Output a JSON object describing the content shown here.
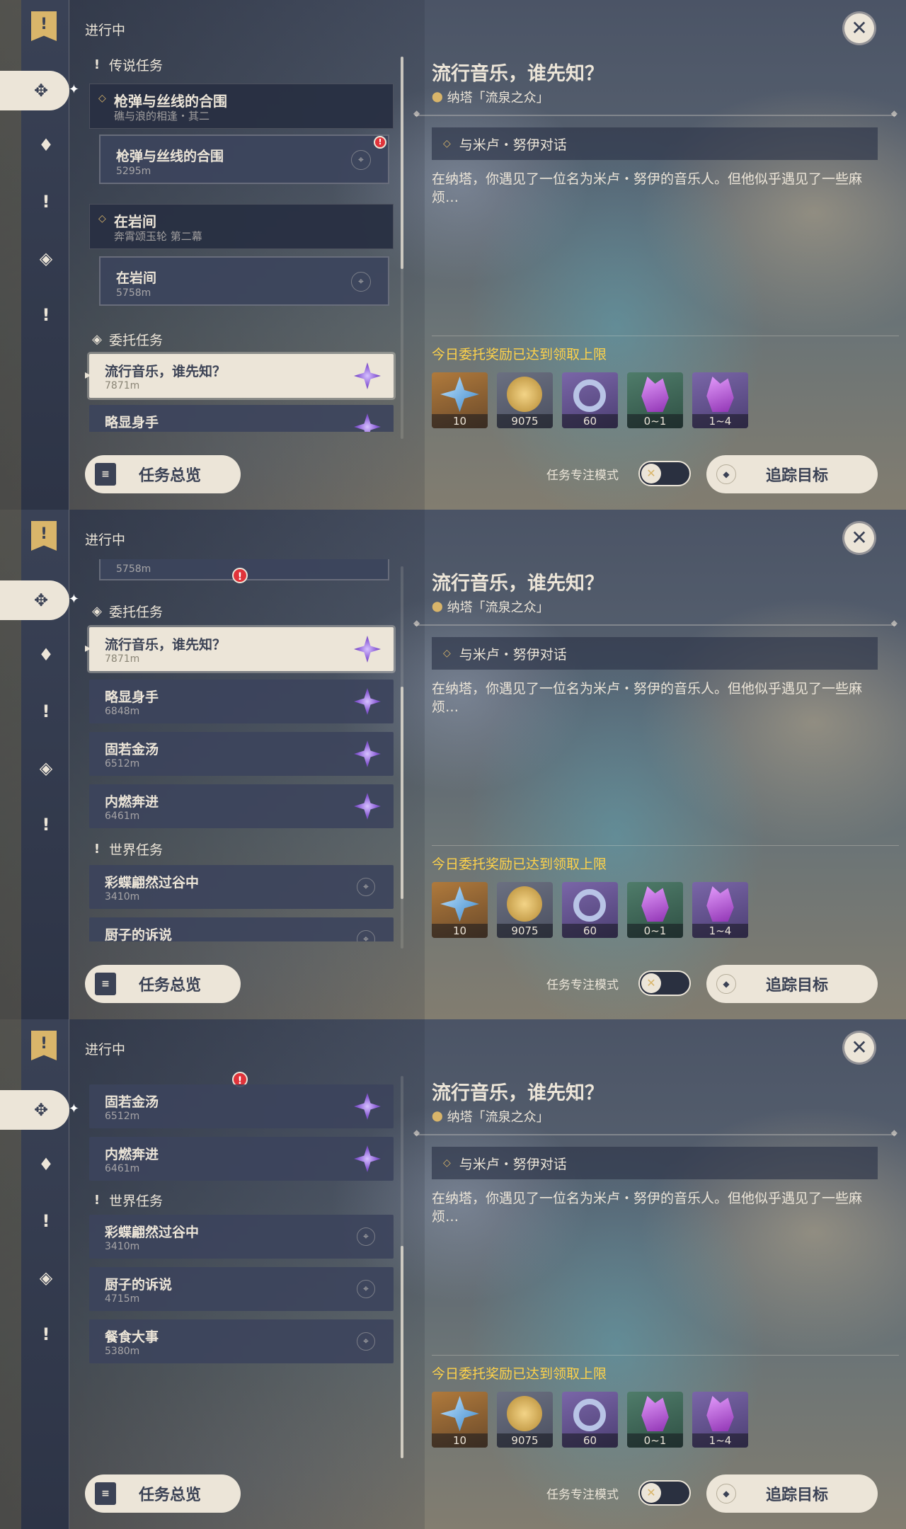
{
  "header": {
    "status_title": "进行中",
    "close_symbol": "✕"
  },
  "rail": {
    "banner_symbol": "!",
    "icons": [
      {
        "name": "all-quests-icon",
        "symbol": "✥"
      },
      {
        "name": "archon-quest-icon",
        "symbol": "♦"
      },
      {
        "name": "world-quest-icon",
        "symbol": "!"
      },
      {
        "name": "commission-icon",
        "symbol": "◈"
      },
      {
        "name": "event-quest-icon",
        "symbol": "!"
      }
    ]
  },
  "sections": {
    "legend": "传说任务",
    "commission": "委托任务",
    "world": "世界任务"
  },
  "legend_quests": [
    {
      "title": "枪弹与丝线的合围",
      "subtitle": "礁与浪的相逢・其二",
      "sub_name": "枪弹与丝线的合围",
      "sub_dist": "5295m"
    },
    {
      "title": "在岩间",
      "subtitle": "奔霄颂玉轮 第二幕",
      "sub_name": "在岩间",
      "sub_dist": "5758m"
    }
  ],
  "commissions": [
    {
      "name": "流行音乐，谁先知？",
      "dist": "7871m"
    },
    {
      "name": "略显身手",
      "dist": "6848m"
    },
    {
      "name": "固若金汤",
      "dist": "6512m"
    },
    {
      "name": "内燃奔进",
      "dist": "6461m"
    }
  ],
  "world_quests": [
    {
      "name": "彩蝶翩然过谷中",
      "dist": "3410m"
    },
    {
      "name": "厨子的诉说",
      "dist": "4715m"
    },
    {
      "name": "餐食大事",
      "dist": "5380m"
    }
  ],
  "partial": {
    "dist_5758": "5758m",
    "dist_6848": "6848"
  },
  "detail": {
    "title": "流行音乐，谁先知？",
    "location": "纳塔「流泉之众」",
    "objective": "与米卢・努伊对话",
    "description": "在纳塔，你遇见了一位名为米卢・努伊的音乐人。但他似乎遇见了一些麻烦…",
    "reward_note": "今日委托奖励已达到领取上限",
    "rewards": [
      {
        "count": "10",
        "color": "#b07a3c",
        "icon": "primogem-icon"
      },
      {
        "count": "9075",
        "color": "#6b7081",
        "icon": "mora-icon"
      },
      {
        "count": "60",
        "color": "#7a66a8",
        "icon": "adventure-exp-icon"
      },
      {
        "count": "0~1",
        "color": "#4f7c6a",
        "icon": "crystal-icon"
      },
      {
        "count": "1~4",
        "color": "#7a66a8",
        "icon": "crystal-cluster-icon"
      }
    ]
  },
  "bottom": {
    "overview_label": "任务总览",
    "focus_label": "任务专注模式",
    "toggle_symbol": "✕",
    "track_label": "追踪目标"
  },
  "colors": {
    "accent": "#ece5d8",
    "reward_note": "#ffd34a",
    "alert": "#e0333a"
  }
}
